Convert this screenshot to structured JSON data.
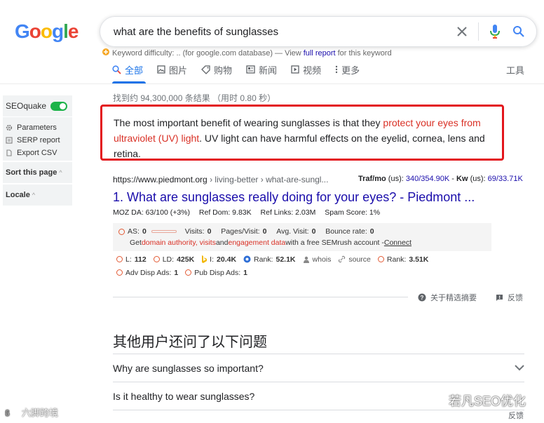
{
  "google": {
    "logo_letters": [
      "G",
      "o",
      "o",
      "g",
      "l",
      "e"
    ],
    "logo_colors": [
      "#4285F4",
      "#EA4335",
      "#FBBC05",
      "#4285F4",
      "#34A853",
      "#EA4335"
    ]
  },
  "search": {
    "query": "what are the benefits of sunglasses"
  },
  "keyword_difficulty": {
    "label": "Keyword difficulty:",
    "value": "..",
    "note": "(for google.com database) — View",
    "link": "full report",
    "suffix": "for this keyword"
  },
  "tabs": [
    {
      "label": "全部",
      "icon": "search-icon"
    },
    {
      "label": "图片",
      "icon": "image-icon"
    },
    {
      "label": "购物",
      "icon": "tag-icon"
    },
    {
      "label": "新闻",
      "icon": "news-icon"
    },
    {
      "label": "视频",
      "icon": "video-icon"
    },
    {
      "label": "更多",
      "icon": "more-vert-icon"
    }
  ],
  "tools_label": "工具",
  "seoquake": {
    "title": "SEOquake",
    "items": [
      {
        "label": "Parameters",
        "icon": "gear-icon"
      },
      {
        "label": "SERP report",
        "icon": "report-icon"
      },
      {
        "label": "Export CSV",
        "icon": "export-icon"
      }
    ],
    "sort_label": "Sort this page",
    "locale_label": "Locale"
  },
  "stats": "找到约 94,300,000 条结果  （用时 0.80 秒）",
  "snippet": {
    "pre": "The most important benefit of wearing sunglasses is that they ",
    "highlight": "protect your eyes from ultraviolet (UV) light",
    "post": ". UV light can have harmful effects on the eyelid, cornea, lens and retina."
  },
  "result": {
    "site": "https://www.piedmont.org",
    "path": " › living-better › what-are-sungl...",
    "traf_label": "Traf/mo",
    "traf_us": " (us): ",
    "traf_value": "340/354.90K",
    "kw_sep": " - ",
    "kw_label": "Kw",
    "kw_us": " (us): ",
    "kw_value": "69/33.71K",
    "title": "1. What are sunglasses really doing for your eyes? - Piedmont ...",
    "moz": [
      "MOZ DA: 63/100 (+3%)",
      "Ref Dom: 9.83K",
      "Ref Links: 2.03M",
      "Spam Score: 1%"
    ]
  },
  "semrush": {
    "as_label": "AS:",
    "as_value": "0",
    "visits_label": "Visits:",
    "visits_value": "0",
    "pages_label": "Pages/Visit:",
    "pages_value": "0",
    "avg_label": "Avg. Visit:",
    "avg_value": "0",
    "bounce_label": "Bounce rate:",
    "bounce_value": "0",
    "get": "Get ",
    "da_link": "domain authority, visits",
    "and": " and ",
    "ed_link": "engagement data",
    "free": " with a free SEMrush account - ",
    "connect": "Connect"
  },
  "metrics": {
    "row1": [
      {
        "label": "L:",
        "value": "112",
        "icon": "google-ring-icon"
      },
      {
        "label": "LD:",
        "value": "425K",
        "icon": "google-ring-icon"
      },
      {
        "label": "I:",
        "value": "20.4K",
        "icon": "bing-icon"
      },
      {
        "label": "Rank:",
        "value": "52.1K",
        "icon": "semrush-icon"
      },
      {
        "label": "whois",
        "value": "",
        "icon": "person-icon"
      },
      {
        "label": "source",
        "value": "",
        "icon": "link-icon"
      },
      {
        "label": "Rank:",
        "value": "3.51K",
        "icon": "google-ring-icon"
      }
    ],
    "row2": [
      {
        "label": "Adv Disp Ads:",
        "value": "1",
        "icon": "google-ring-icon"
      },
      {
        "label": "Pub Disp Ads:",
        "value": "1",
        "icon": "google-ring-icon"
      }
    ]
  },
  "featured_snippet": {
    "about": "关于精选摘要",
    "feedback": "反馈"
  },
  "paa": {
    "title": "其他用户还问了以下问题",
    "questions": [
      "Why are sunglasses so important?",
      "Is it healthy to wear sunglasses?"
    ],
    "feedback": "反馈"
  },
  "watermarks": {
    "left": "六脚跨境",
    "right": "若凡SEO优化"
  }
}
